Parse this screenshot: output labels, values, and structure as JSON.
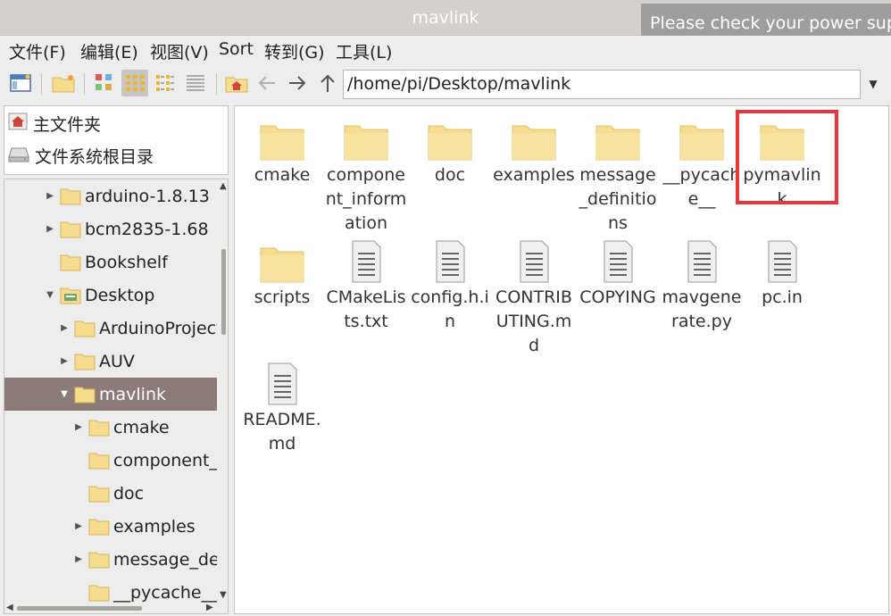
{
  "window": {
    "title": "mavlink"
  },
  "notification": {
    "text": "Please check your power suppl"
  },
  "menu": [
    "文件(F)",
    "编辑(E)",
    "视图(V)",
    "Sort",
    "转到(G)",
    "工具(L)"
  ],
  "toolbar": {
    "icons": [
      "new-window-icon",
      "new-folder-icon",
      "icon-view-icon",
      "thumbnail-view-icon",
      "compact-view-icon",
      "detailed-list-icon",
      "home-icon",
      "back-arrow-icon",
      "forward-arrow-icon",
      "up-arrow-icon"
    ],
    "address": "/home/pi/Desktop/mavlink"
  },
  "places": [
    {
      "label": "主文件夹",
      "icon": "home-icon"
    },
    {
      "label": "文件系统根目录",
      "icon": "drive-icon"
    }
  ],
  "tree": [
    {
      "label": "arduino-1.8.13",
      "expander": "▶"
    },
    {
      "label": "bcm2835-1.68",
      "expander": "▶"
    },
    {
      "label": "Bookshelf",
      "expander": ""
    },
    {
      "label": "Desktop",
      "expander": "▼"
    },
    {
      "label": "ArduinoProject",
      "expander": "▶"
    },
    {
      "label": "AUV",
      "expander": "▶"
    },
    {
      "label": "mavlink",
      "expander": "▼",
      "selected": true
    },
    {
      "label": "cmake",
      "expander": "▶"
    },
    {
      "label": "component_i",
      "expander": ""
    },
    {
      "label": "doc",
      "expander": ""
    },
    {
      "label": "examples",
      "expander": "▶"
    },
    {
      "label": "message_def",
      "expander": "▶"
    },
    {
      "label": "__pycache__",
      "expander": ""
    }
  ],
  "files": [
    {
      "name": "cmake",
      "type": "folder"
    },
    {
      "name": "component_information",
      "type": "folder"
    },
    {
      "name": "doc",
      "type": "folder"
    },
    {
      "name": "examples",
      "type": "folder"
    },
    {
      "name": "message_definitions",
      "type": "folder"
    },
    {
      "name": "__pycache__",
      "type": "folder"
    },
    {
      "name": "pymavlink",
      "type": "folder",
      "highlighted": true
    },
    {
      "name": "scripts",
      "type": "folder"
    },
    {
      "name": "CMakeLists.txt",
      "type": "file"
    },
    {
      "name": "config.h.in",
      "type": "file"
    },
    {
      "name": "CONTRIBUTING.md",
      "type": "file"
    },
    {
      "name": "COPYING",
      "type": "file"
    },
    {
      "name": "mavgenerate.py",
      "type": "file"
    },
    {
      "name": "pc.in",
      "type": "file"
    },
    {
      "name": "README.md",
      "type": "file"
    }
  ],
  "colors": {
    "selection": "#8c7c78",
    "folder": "#f6dc8e",
    "highlight": "#e8363b"
  }
}
